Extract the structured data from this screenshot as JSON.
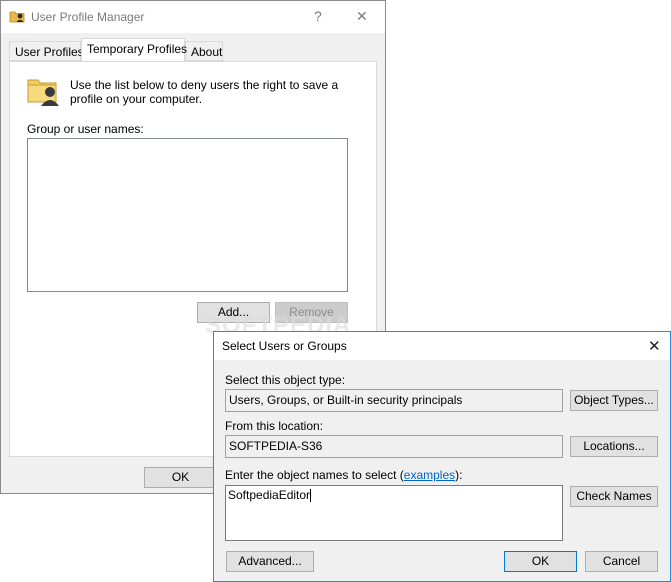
{
  "main_window": {
    "title": "User Profile Manager",
    "help_glyph": "?",
    "close_glyph": "✕",
    "tabs": [
      {
        "label": "User Profiles"
      },
      {
        "label": "Temporary Profiles"
      },
      {
        "label": "About"
      }
    ],
    "description_line1": "Use the list below to deny users the right to save a",
    "description_line2": "profile on your computer.",
    "list_label": "Group or user names:",
    "add_button": "Add...",
    "remove_button": "Remove",
    "ok_button": "OK"
  },
  "dialog": {
    "title": "Select Users or Groups",
    "close_glyph": "✕",
    "object_type_label": "Select this object type:",
    "object_type_value": "Users, Groups, or Built-in security principals",
    "object_types_button": "Object Types...",
    "location_label": "From this location:",
    "location_value": "SOFTPEDIA-S36",
    "locations_button": "Locations...",
    "enter_names_label_prefix": "Enter the object names to select (",
    "enter_names_link": "examples",
    "enter_names_label_suffix": "):",
    "names_value": "SoftpediaEditor",
    "check_names_button": "Check Names",
    "advanced_button": "Advanced...",
    "ok_button": "OK",
    "cancel_button": "Cancel"
  },
  "watermark": "SOFTPEDIA"
}
